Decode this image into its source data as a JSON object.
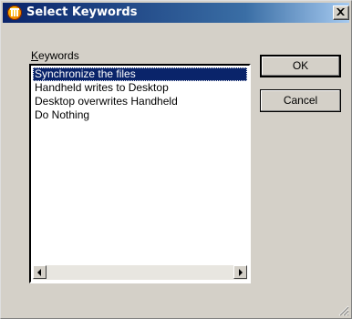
{
  "window": {
    "title": "Select Keywords",
    "icon": "app-logo-icon"
  },
  "keywords": {
    "label_accel": "K",
    "label_rest": "eywords",
    "items": [
      "Synchronize the files",
      "Handheld writes to Desktop",
      "Desktop overwrites Handheld",
      "Do Nothing"
    ],
    "selected_index": 0
  },
  "buttons": {
    "ok": "OK",
    "cancel": "Cancel"
  },
  "colors": {
    "titlebar_start": "#0a246a",
    "titlebar_end": "#a6caf0",
    "selection": "#0a246a",
    "face": "#d4d0c8"
  }
}
